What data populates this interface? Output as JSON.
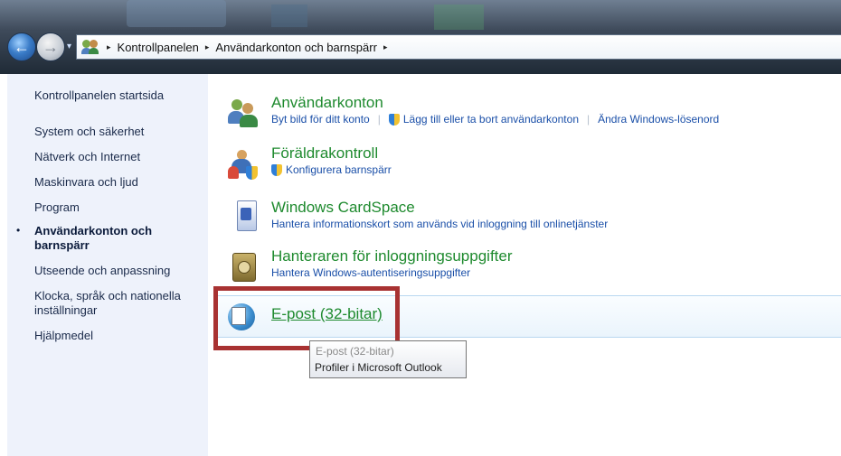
{
  "address_bar": {
    "crumbs": [
      "Kontrollpanelen",
      "Användarkonton och barnspärr"
    ],
    "separator": "▸",
    "dropdown_glyph": "▾"
  },
  "nav": {
    "back_glyph": "←",
    "forward_glyph": "→"
  },
  "sidebar": {
    "bullet": "•",
    "items": [
      {
        "label": "Kontrollpanelen startsida"
      },
      {
        "label": "System och säkerhet"
      },
      {
        "label": "Nätverk och Internet"
      },
      {
        "label": "Maskinvara och ljud"
      },
      {
        "label": "Program"
      },
      {
        "label": "Användarkonton och barnspärr"
      },
      {
        "label": "Utseende och anpassning"
      },
      {
        "label": "Klocka, språk och nationella inställningar"
      },
      {
        "label": "Hjälpmedel"
      }
    ],
    "active_index": 5
  },
  "categories": [
    {
      "title": "Användarkonton",
      "icon": "users-icon",
      "links": [
        "Byt bild för ditt konto",
        "Lägg till eller ta bort användarkonton",
        "Ändra Windows-lösenord"
      ]
    },
    {
      "title": "Föräldrakontroll",
      "icon": "family-safety-icon",
      "links": [
        "Konfigurera barnspärr"
      ]
    },
    {
      "title": "Windows CardSpace",
      "icon": "cardspace-icon",
      "links": [
        "Hantera informationskort som används vid inloggning till onlinetjänster"
      ]
    },
    {
      "title": "Hanteraren för inloggningsuppgifter",
      "icon": "credential-vault-icon",
      "links": [
        "Hantera Windows-autentiseringsuppgifter"
      ]
    },
    {
      "title": "E-post (32-bitar)",
      "icon": "mail-icon",
      "links": []
    }
  ],
  "tooltip": {
    "title": "E-post (32-bitar)",
    "text": "Profiler i Microsoft Outlook"
  },
  "colors": {
    "category_title": "#1e8a2e",
    "link": "#1a4fa8",
    "highlight_border": "#a83232",
    "sidebar_bg": "#eef2fb"
  }
}
